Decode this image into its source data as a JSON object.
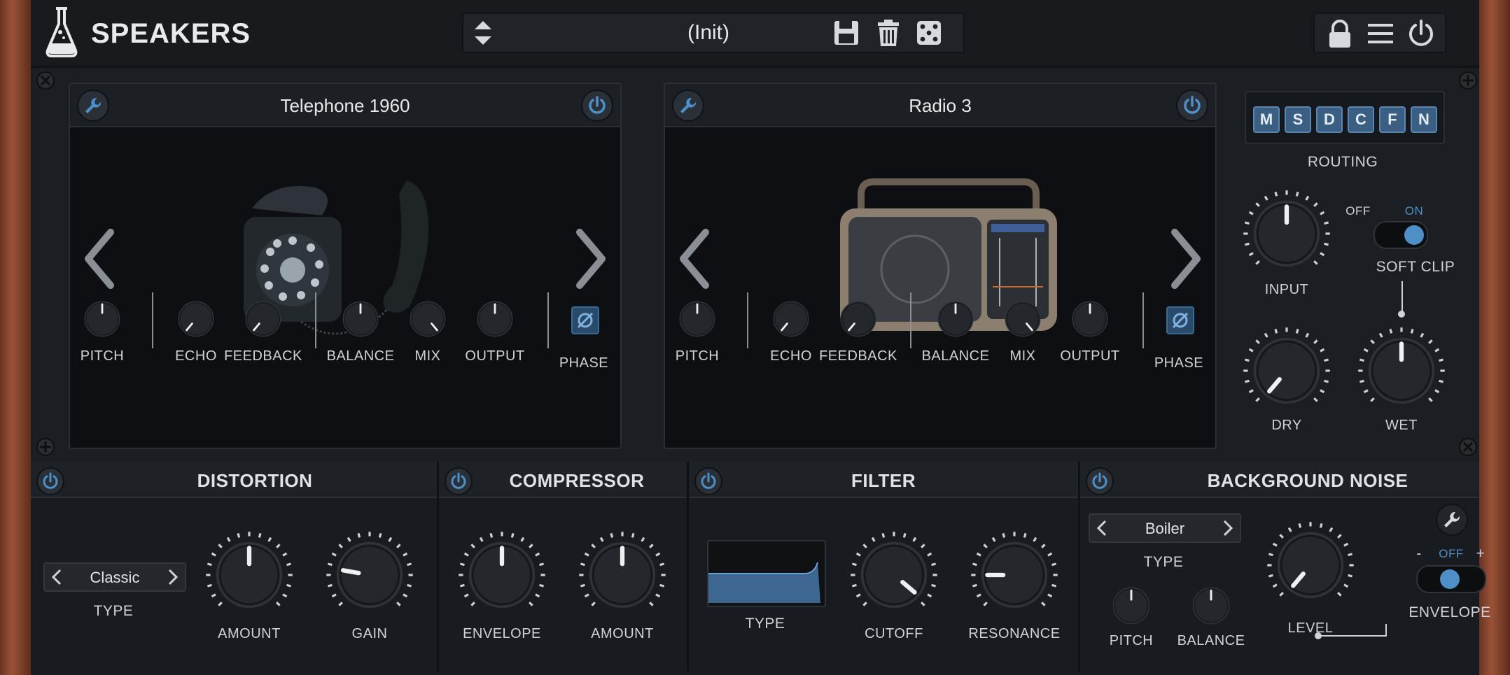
{
  "header": {
    "app_title": "SPEAKERS",
    "preset_name": "(Init)",
    "icons": [
      "flask-logo-icon",
      "preset-up-down-icon",
      "save-icon",
      "trash-icon",
      "dice-icon",
      "lock-icon",
      "menu-icon",
      "power-icon"
    ]
  },
  "speakers": [
    {
      "name": "Telephone 1960",
      "knobs": {
        "pitch": "PITCH",
        "echo": "ECHO",
        "feedback": "FEEDBACK",
        "balance": "BALANCE",
        "mix": "MIX",
        "output": "OUTPUT",
        "phase": "PHASE"
      }
    },
    {
      "name": "Radio 3",
      "knobs": {
        "pitch": "PITCH",
        "echo": "ECHO",
        "feedback": "FEEDBACK",
        "balance": "BALANCE",
        "mix": "MIX",
        "output": "OUTPUT",
        "phase": "PHASE"
      }
    }
  ],
  "routing": {
    "label": "ROUTING",
    "buttons": [
      "M",
      "S",
      "D",
      "C",
      "F",
      "N"
    ]
  },
  "master": {
    "input_label": "INPUT",
    "softclip_off": "OFF",
    "softclip_on": "ON",
    "softclip_label": "SOFT CLIP",
    "dry_label": "DRY",
    "wet_label": "WET"
  },
  "distortion": {
    "title": "DISTORTION",
    "type_value": "Classic",
    "type_label": "TYPE",
    "amount_label": "AMOUNT",
    "gain_label": "GAIN"
  },
  "compressor": {
    "title": "COMPRESSOR",
    "envelope_label": "ENVELOPE",
    "amount_label": "AMOUNT"
  },
  "filter": {
    "title": "FILTER",
    "type_label": "TYPE",
    "cutoff_label": "CUTOFF",
    "resonance_label": "RESONANCE"
  },
  "background_noise": {
    "title": "BACKGROUND NOISE",
    "type_value": "Boiler",
    "type_label": "TYPE",
    "pitch_label": "PITCH",
    "balance_label": "BALANCE",
    "level_label": "LEVEL",
    "env_minus": "-",
    "env_off": "OFF",
    "env_plus": "+",
    "envelope_label": "ENVELOPE"
  },
  "colors": {
    "accent_blue": "#4f8fc8",
    "wood": "#8a4a31",
    "panel": "#1b1e22"
  }
}
